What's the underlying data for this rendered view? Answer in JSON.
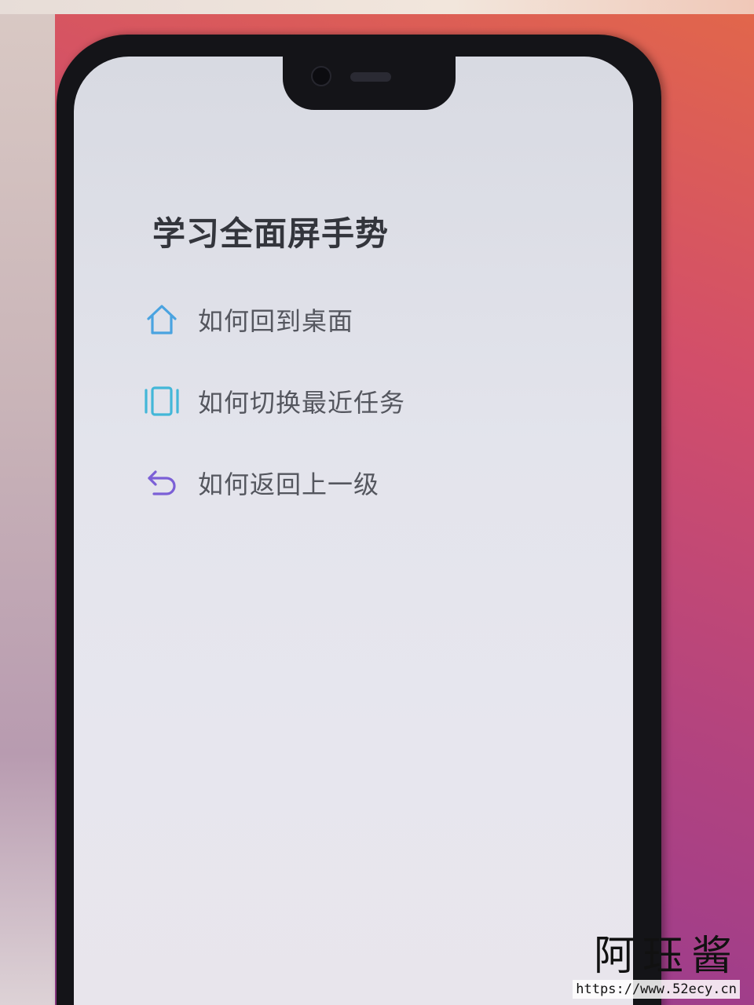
{
  "page": {
    "title": "学习全面屏手势"
  },
  "menu": {
    "items": [
      {
        "label": "如何回到桌面",
        "icon": "home-icon",
        "color": "#4aa3e0"
      },
      {
        "label": "如何切换最近任务",
        "icon": "recent-tasks-icon",
        "color": "#43b7d8"
      },
      {
        "label": "如何返回上一级",
        "icon": "back-arrow-icon",
        "color": "#7b5fd6"
      }
    ]
  },
  "watermark": {
    "name": "阿珏酱",
    "url": "https://www.52ecy.cn"
  }
}
